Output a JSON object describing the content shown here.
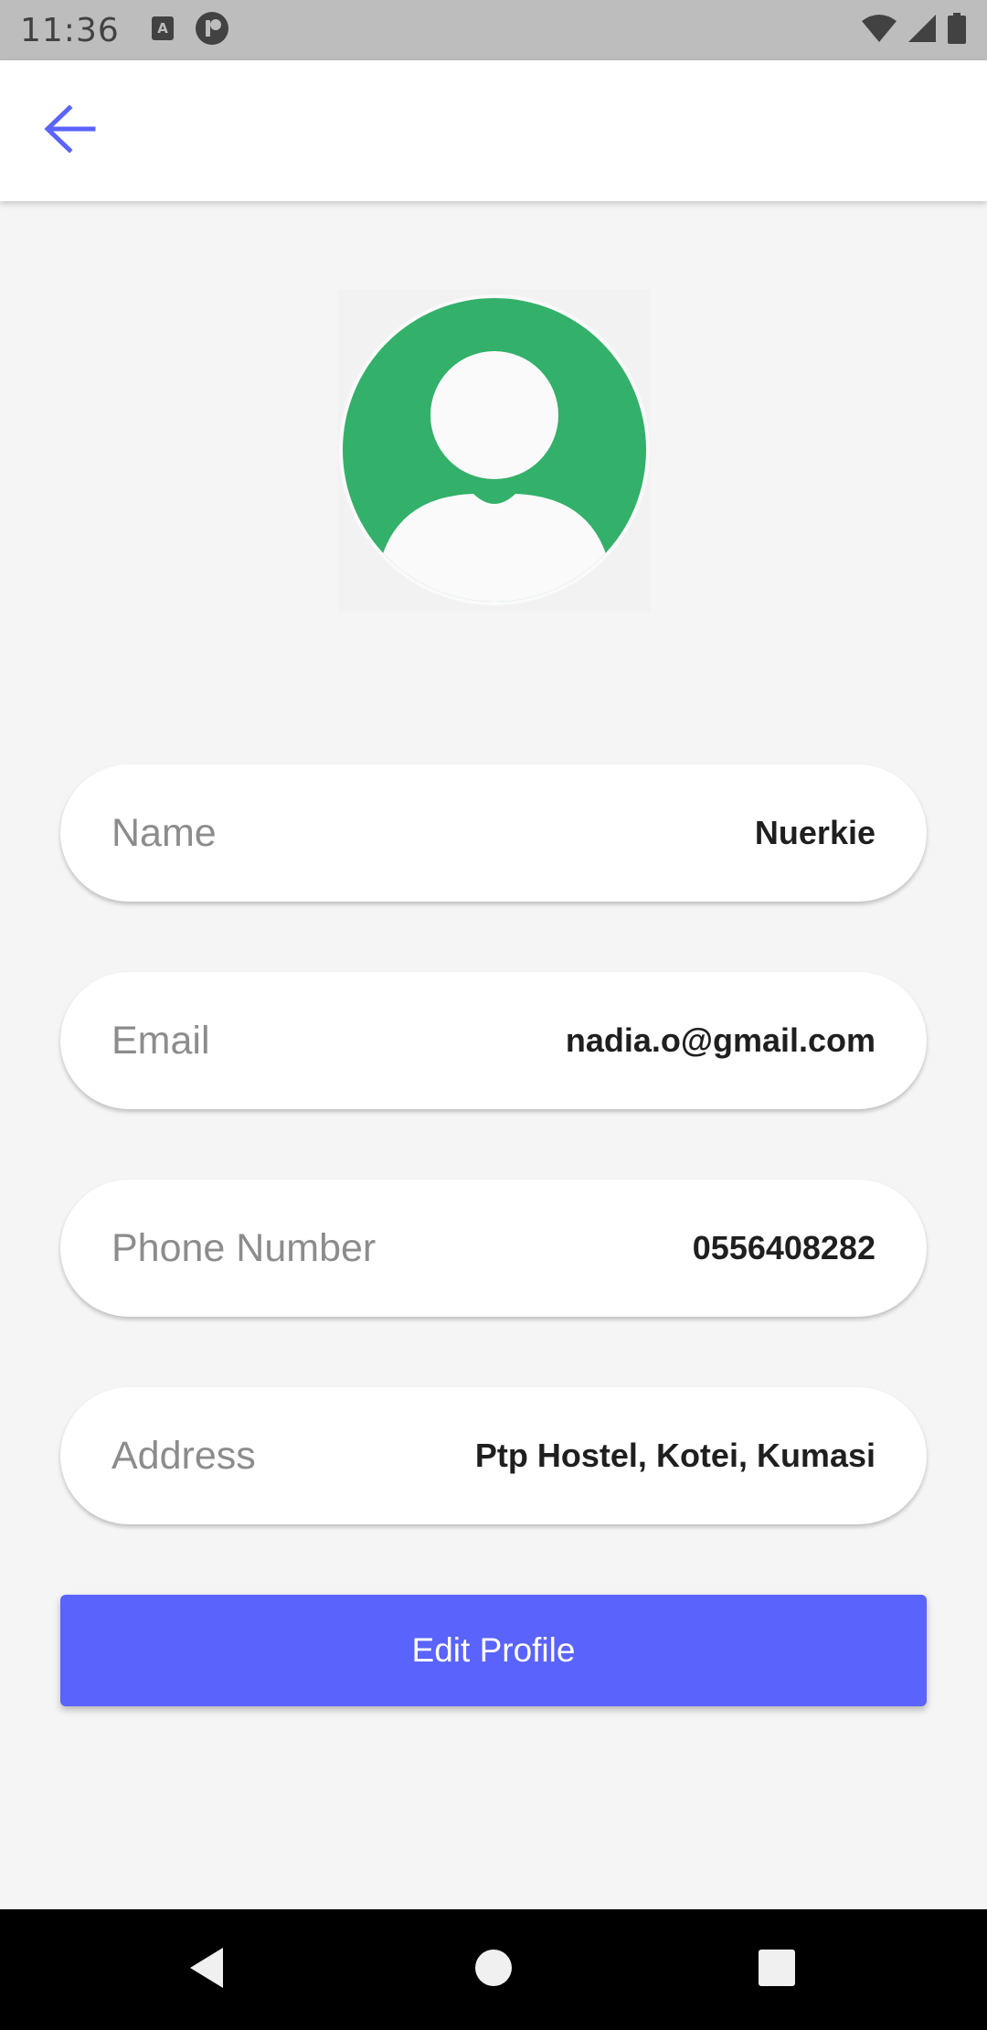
{
  "status_bar": {
    "time": "11:36",
    "icons": [
      "a-notification-icon",
      "pause-circle-icon",
      "wifi-icon",
      "signal-icon",
      "battery-icon"
    ]
  },
  "app_bar": {
    "back_icon": "arrow-left-icon",
    "accent_color": "#5a63fb"
  },
  "avatar": {
    "icon": "user-avatar-icon",
    "color": "#33b06a"
  },
  "profile": {
    "fields": [
      {
        "label": "Name",
        "value": "Nuerkie"
      },
      {
        "label": "Email",
        "value": "nadia.o@gmail.com"
      },
      {
        "label": "Phone Number",
        "value": "0556408282"
      },
      {
        "label": "Address",
        "value": "Ptp Hostel, Kotei, Kumasi"
      }
    ]
  },
  "actions": {
    "edit_label": "Edit Profile",
    "button_color": "#5a63fb"
  },
  "nav_bar": {
    "icons": [
      "back-triangle-icon",
      "home-circle-icon",
      "recents-square-icon"
    ]
  }
}
